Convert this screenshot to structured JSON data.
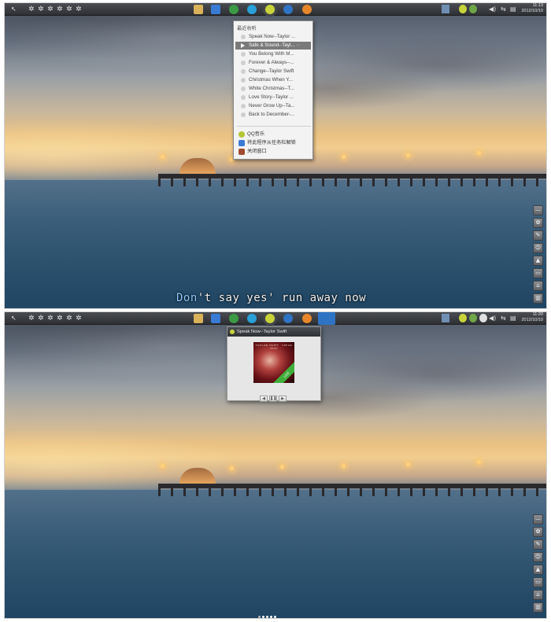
{
  "colors": {
    "taskbar": "#2e3034",
    "menu_bg": "#f3f3f3",
    "menu_active": "#7a7a7a",
    "lyric_highlight": "#8cc8ff",
    "lyric_text": "#f3f3f3"
  },
  "top": {
    "taskbar": {
      "clock_time": "11:13",
      "clock_date": "2012/10/10",
      "gear_icons": 6
    },
    "menu": {
      "title": "最近收听",
      "items": [
        {
          "label": "Speak Now--Taylor ..."
        },
        {
          "label": "Safe & Sound--Tayl...  ··"
        },
        {
          "label": "You Belong With M..."
        },
        {
          "label": "Forever & Always--..."
        },
        {
          "label": "Change--Taylor Swift"
        },
        {
          "label": "Christmas When Y..."
        },
        {
          "label": "White Christmas--T..."
        },
        {
          "label": "Love Story--Taylor ..."
        },
        {
          "label": "Never Grow Up--Ta..."
        },
        {
          "label": "Back to December-..."
        }
      ],
      "active_index": 1,
      "actions": [
        {
          "label": "QQ音乐",
          "icon": "qqmusic-icon",
          "color": "#b3c532"
        },
        {
          "label": "将此程序从任务栏解锁",
          "icon": "pin-icon",
          "color": "#3a7bd5"
        },
        {
          "label": "关闭窗口",
          "icon": "close-window-icon",
          "color": "#a04b2f"
        }
      ]
    },
    "lyrics": {
      "highlight": "Don",
      "rest": "'t say yes' run away now"
    }
  },
  "bottom": {
    "taskbar": {
      "clock_time": "11:20",
      "clock_date": "2012/10/10"
    },
    "now_playing": {
      "title": "Speak Now--Taylor Swift",
      "cover_band": "TAYLOR SWIFT · SPEAK NOW",
      "cover_badge": "LIVE",
      "controls": [
        "◀",
        "❚❚",
        "▶"
      ]
    },
    "pager": {
      "count": 5,
      "active_index": 1
    }
  },
  "dock_icons": [
    "minimize-icon",
    "settings-icon",
    "edit-icon",
    "users-icon",
    "print-icon",
    "monitor-icon",
    "home-icon",
    "trash-icon"
  ]
}
